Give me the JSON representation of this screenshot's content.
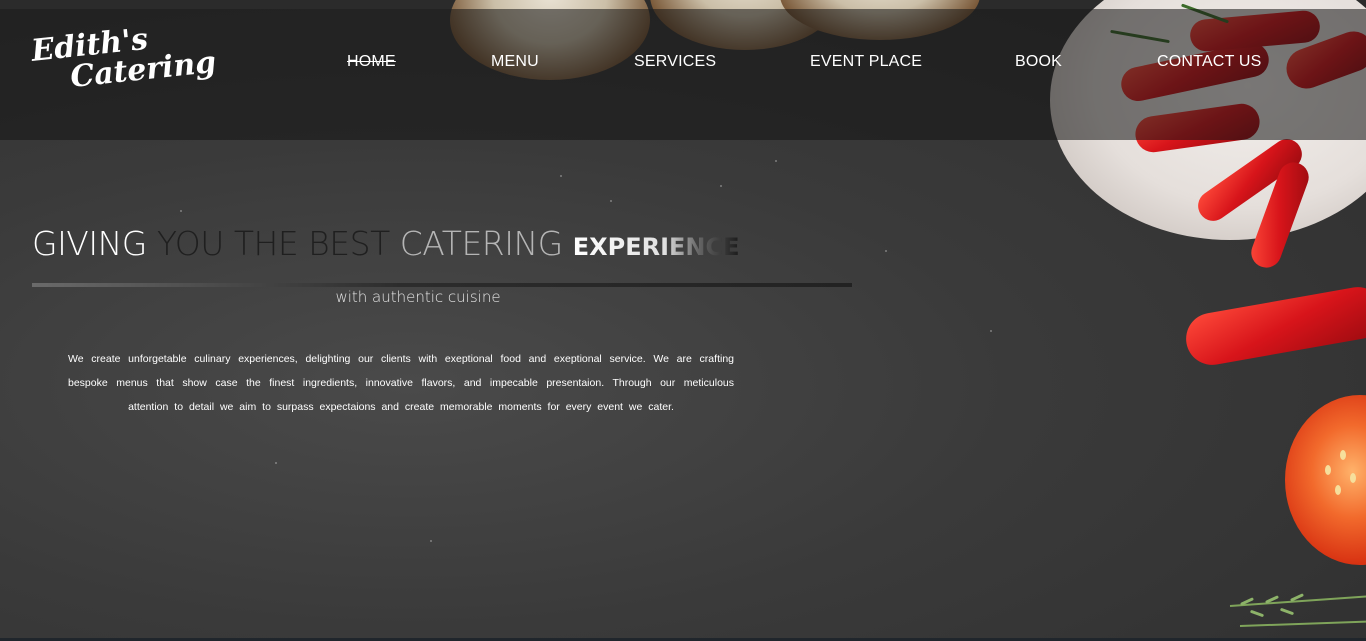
{
  "header": {
    "logo_line1": "Edith's",
    "logo_line2": "Catering",
    "nav": [
      {
        "label": "HOME",
        "active": true
      },
      {
        "label": "MENU",
        "active": false
      },
      {
        "label": "SERVICES",
        "active": false
      },
      {
        "label": "EVENT PLACE",
        "active": false
      },
      {
        "label": "BOOK",
        "active": false
      },
      {
        "label": "CONTACT US",
        "active": false
      }
    ]
  },
  "hero": {
    "title_part1": "GIVING",
    "title_part2": "YOU THE BEST",
    "title_part3": "CATERING",
    "title_part4": "EXPERIENCE",
    "subtitle": "with authentic cuisine",
    "body": "We create unforgetable culinary experiences, delighting our clients with exeptional food and exeptional service. We are crafting bespoke menus that show case the finest ingredients, innovative flavors, and impecable presentaion. Through our meticulous attention to detail we aim to surpass expectaions and create memorable moments for every event we cater."
  },
  "colors": {
    "background": "#3c3c3c",
    "header_overlay": "#141414",
    "text_primary": "#ffffff",
    "accent_red": "#d7141a"
  }
}
